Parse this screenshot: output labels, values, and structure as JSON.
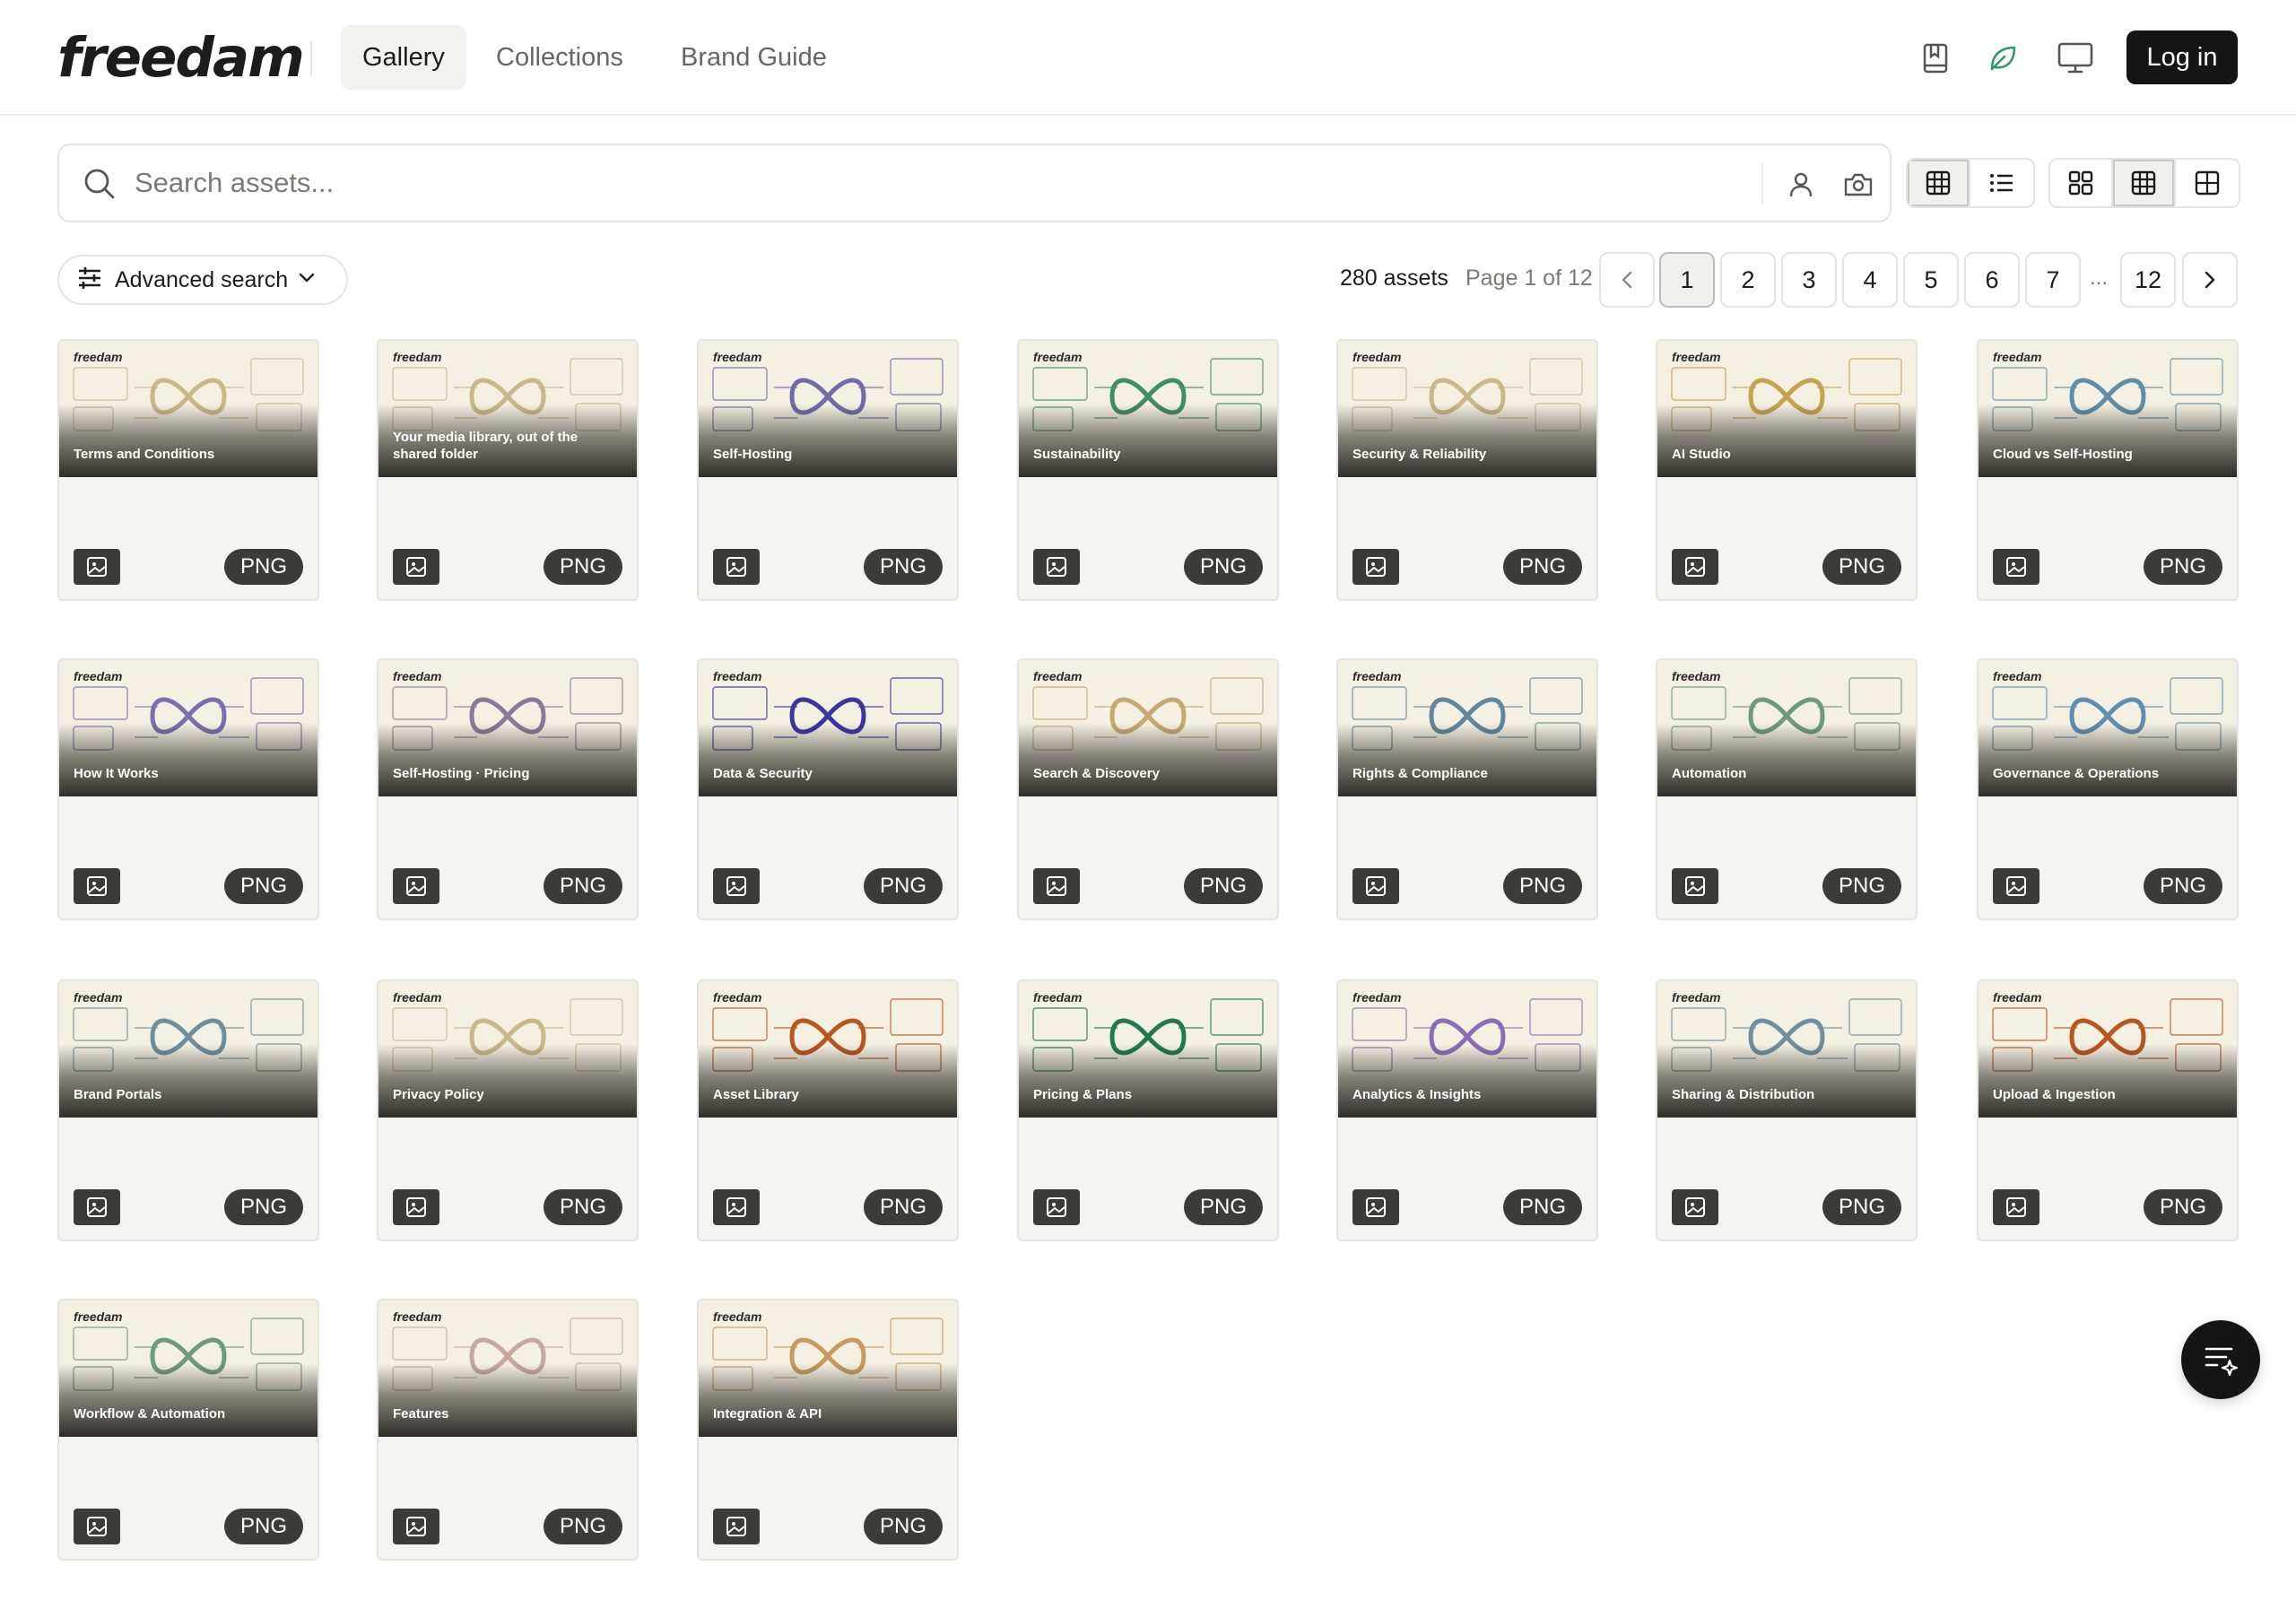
{
  "header": {
    "logo": "freedam",
    "nav": [
      {
        "label": "Gallery",
        "active": true
      },
      {
        "label": "Collections",
        "active": false
      },
      {
        "label": "Brand Guide",
        "active": false
      }
    ],
    "icons": [
      "book-icon",
      "leaf-icon",
      "monitor-icon"
    ],
    "login_label": "Log in"
  },
  "search": {
    "placeholder": "Search assets...",
    "value": ""
  },
  "view_toggles": {
    "layout": [
      "table-grid-icon",
      "list-icon"
    ],
    "density": [
      "grid-small-icon",
      "grid-medium-icon",
      "grid-large-icon"
    ],
    "active_layout": "table-grid-icon",
    "active_density": "grid-medium-icon"
  },
  "toolbar": {
    "advanced_search_label": "Advanced search",
    "asset_count": "280 assets",
    "page_info": "Page 1 of 12",
    "pages": [
      "1",
      "2",
      "3",
      "4",
      "5",
      "6",
      "7",
      "12"
    ],
    "current_page": "1",
    "ellipsis": "..."
  },
  "brand_label": "freedam",
  "cards": [
    {
      "title": "Terms and Conditions",
      "type": "PNG",
      "accent": "#c9b88a"
    },
    {
      "title": "Your media library, out of the shared folder",
      "type": "PNG",
      "accent": "#c9b88a"
    },
    {
      "title": "Self-Hosting",
      "type": "PNG",
      "accent": "#6f6ca8"
    },
    {
      "title": "Sustainability",
      "type": "PNG",
      "accent": "#3f8f5f"
    },
    {
      "title": "Security & Reliability",
      "type": "PNG",
      "accent": "#c9b88a"
    },
    {
      "title": "AI Studio",
      "type": "PNG",
      "accent": "#c7a24e"
    },
    {
      "title": "Cloud vs Self-Hosting",
      "type": "PNG",
      "accent": "#5f8fa8"
    },
    {
      "title": "How It Works",
      "type": "PNG",
      "accent": "#7a6fb0"
    },
    {
      "title": "Self-Hosting · Pricing",
      "type": "PNG",
      "accent": "#8a7a9a"
    },
    {
      "title": "Data & Security",
      "type": "PNG",
      "accent": "#3a35a0"
    },
    {
      "title": "Search & Discovery",
      "type": "PNG",
      "accent": "#c7a870"
    },
    {
      "title": "Rights & Compliance",
      "type": "PNG",
      "accent": "#5f87a0"
    },
    {
      "title": "Automation",
      "type": "PNG",
      "accent": "#6f9a7a"
    },
    {
      "title": "Governance & Operations",
      "type": "PNG",
      "accent": "#5f8fb0"
    },
    {
      "title": "Brand Portals",
      "type": "PNG",
      "accent": "#6f8fa0"
    },
    {
      "title": "Privacy Policy",
      "type": "PNG",
      "accent": "#c9b88a"
    },
    {
      "title": "Asset Library",
      "type": "PNG",
      "accent": "#b8561e"
    },
    {
      "title": "Pricing & Plans",
      "type": "PNG",
      "accent": "#1f7a4f"
    },
    {
      "title": "Analytics & Insights",
      "type": "PNG",
      "accent": "#8a6fb8"
    },
    {
      "title": "Sharing & Distribution",
      "type": "PNG",
      "accent": "#6f8fa0"
    },
    {
      "title": "Upload & Ingestion",
      "type": "PNG",
      "accent": "#b8561e"
    },
    {
      "title": "Workflow & Automation",
      "type": "PNG",
      "accent": "#6f9a7a"
    },
    {
      "title": "Features",
      "type": "PNG",
      "accent": "#c7a8a0"
    },
    {
      "title": "Integration & API",
      "type": "PNG",
      "accent": "#c79a5e"
    }
  ],
  "fab_icon": "filter-sparkle-icon"
}
